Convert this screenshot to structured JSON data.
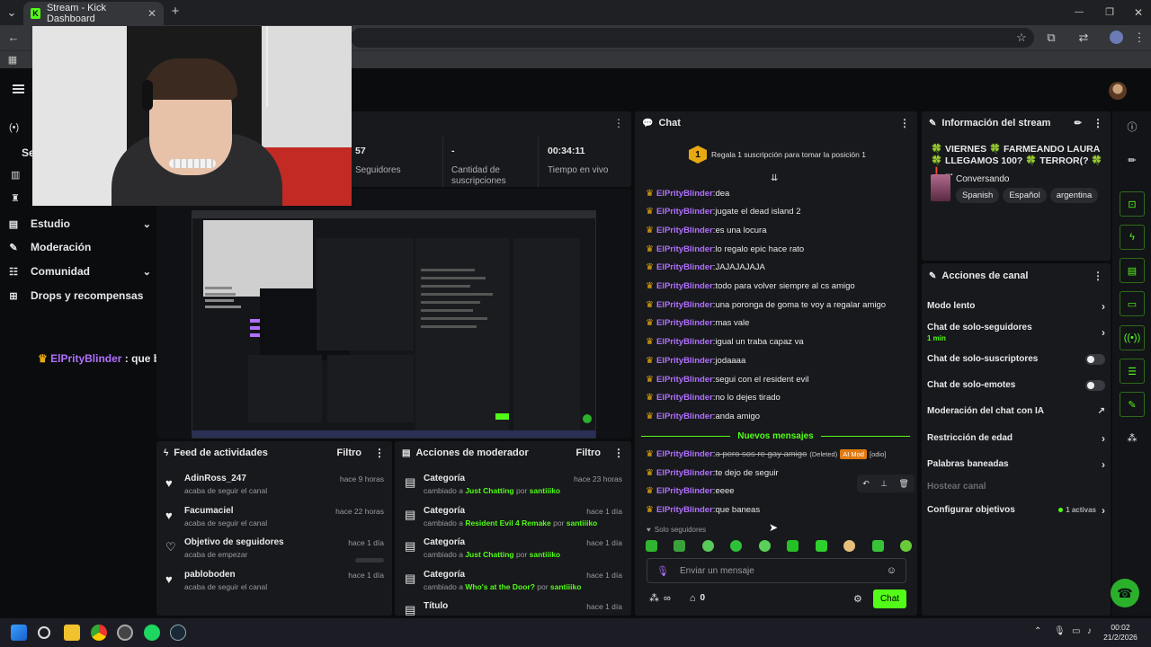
{
  "browser": {
    "tab_title": "Stream - Kick Dashboard",
    "tab_close": "✕",
    "new_tab": "+",
    "window_min": "—",
    "window_max": "❐",
    "window_close": "✕"
  },
  "nav": {
    "items": [
      {
        "label": "Estudio",
        "icon": "studio-icon",
        "has_chevron": true
      },
      {
        "label": "Moderación",
        "icon": "wrench-icon",
        "has_chevron": false
      },
      {
        "label": "Comunidad",
        "icon": "community-icon",
        "has_chevron": true
      },
      {
        "label": "Drops y recompensas",
        "icon": "drops-icon",
        "has_chevron": false
      }
    ],
    "partial_label": "Se"
  },
  "overlay_chat": {
    "user": "ElPrityBlinder",
    "separator": " : ",
    "message": "que baneas"
  },
  "stats": [
    {
      "value": "57",
      "label": "Seguidores"
    },
    {
      "value": "-",
      "label": "Cantidad de suscripciones"
    },
    {
      "value": "00:34:11",
      "label": "Tiempo en vivo"
    }
  ],
  "chat": {
    "title": "Chat",
    "subgoal_number": "1",
    "subgoal_text": "Regala 1 suscripción para tomar la posición 1",
    "messages": [
      {
        "user": "ElPrityBlinder",
        "text": "dea"
      },
      {
        "user": "ElPrityBlinder",
        "text": "jugate el dead island 2"
      },
      {
        "user": "ElPrityBlinder",
        "text": "es una locura"
      },
      {
        "user": "ElPrityBlinder",
        "text": "lo regalo epic hace rato"
      },
      {
        "user": "ElPrityBlinder",
        "text": "JAJAJAJAJA"
      },
      {
        "user": "ElPrityBlinder",
        "text": "todo para volver siempre al cs amigo"
      },
      {
        "user": "ElPrityBlinder",
        "text": "una poronga de goma te voy a regalar amigo"
      },
      {
        "user": "ElPrityBlinder",
        "text": "mas vale"
      },
      {
        "user": "ElPrityBlinder",
        "text": "igual un traba capaz va"
      },
      {
        "user": "ElPrityBlinder",
        "text": "jodaaaa"
      },
      {
        "user": "ElPrityBlinder",
        "text": "segui con el resident evil"
      },
      {
        "user": "ElPrityBlinder",
        "text": "no lo dejes tirado"
      },
      {
        "user": "ElPrityBlinder",
        "text": "anda amigo"
      }
    ],
    "new_messages_label": "Nuevos mensajes",
    "deleted_message": {
      "user": "ElPrityBlinder",
      "text": "a pero sos re gay amigo",
      "deleted_tag": "(Deleted)",
      "ai_mod_tag": "AI Mod",
      "reason": "[odio]"
    },
    "new_messages": [
      {
        "user": "ElPrityBlinder",
        "text": "te dejo de seguir"
      },
      {
        "user": "ElPrityBlinder",
        "text": "eeee"
      },
      {
        "user": "ElPrityBlinder",
        "text": "que baneas"
      }
    ],
    "followers_only_label": "Solo seguidores",
    "input_placeholder": "Enviar un mensaje",
    "points_count": "0",
    "send_label": "Chat"
  },
  "stream_info": {
    "title": "Información del stream",
    "stream_title": "🍀 VIERNES 🍀 FARMEANDO LAURA 🍀 LLEGAMOS 100? 🍀 TERROR(? 🍀 ❗ ...",
    "category": "Conversando",
    "tags": [
      "Spanish",
      "Español",
      "argentina"
    ]
  },
  "channel_actions": {
    "title": "Acciones de canal",
    "rows": [
      {
        "label": "Modo lento",
        "kind": "chevron"
      },
      {
        "label": "Chat de solo-seguidores",
        "sub": "1 min",
        "kind": "chevron"
      },
      {
        "label": "Chat de solo-suscriptores",
        "kind": "toggle"
      },
      {
        "label": "Chat de solo-emotes",
        "kind": "toggle"
      },
      {
        "label": "Moderación del chat con IA",
        "kind": "external"
      },
      {
        "label": "Restricción de edad",
        "kind": "chevron"
      },
      {
        "label": "Palabras baneadas",
        "kind": "chevron"
      },
      {
        "label": "Hostear canal",
        "kind": "disabled"
      },
      {
        "label": "Configurar objetivos",
        "badge": "1 activas",
        "kind": "chevron"
      }
    ]
  },
  "activity_feed": {
    "title": "Feed de actividades",
    "filter": "Filtro",
    "items": [
      {
        "name": "AdinRoss_247",
        "sub": "acaba de seguir el canal",
        "time": "hace 9 horas",
        "icon": "heart-icon"
      },
      {
        "name": "Facumaciel",
        "sub": "acaba de seguir el canal",
        "time": "hace 22 horas",
        "icon": "heart-icon"
      },
      {
        "name": "Objetivo de seguidores",
        "sub": "acaba de empezar",
        "time": "hace 1 día",
        "icon": "heart-outline-icon",
        "progress": 0
      },
      {
        "name": "pabloboden",
        "sub": "acaba de seguir el canal",
        "time": "hace 1 día",
        "icon": "heart-icon"
      }
    ]
  },
  "mod_actions": {
    "title": "Acciones de moderador",
    "filter": "Filtro",
    "items": [
      {
        "title": "Categoría",
        "prefix": "cambiado a ",
        "target": "Just Chatting",
        "by": " por ",
        "mod": "santiiiko",
        "time": "hace 23 horas"
      },
      {
        "title": "Categoría",
        "prefix": "cambiado a ",
        "target": "Resident Evil 4 Remake",
        "by": " por ",
        "mod": "santiiiko",
        "time": "hace 1 día"
      },
      {
        "title": "Categoría",
        "prefix": "cambiado a ",
        "target": "Just Chatting",
        "by": " por ",
        "mod": "santiiiko",
        "time": "hace 1 día"
      },
      {
        "title": "Categoría",
        "prefix": "cambiado a ",
        "target": "Who's at the Door?",
        "by": " por ",
        "mod": "santiiiko",
        "time": "hace 1 día"
      },
      {
        "title": "Título",
        "time": "hace 1 día"
      }
    ]
  },
  "taskbar": {
    "time": "00:02",
    "date": "21/2/2026"
  },
  "colors": {
    "accent": "#53fc18",
    "username": "#b070ff",
    "crown": "#e6a90f",
    "panel": "#18191c",
    "background": "#0b0c0e"
  }
}
